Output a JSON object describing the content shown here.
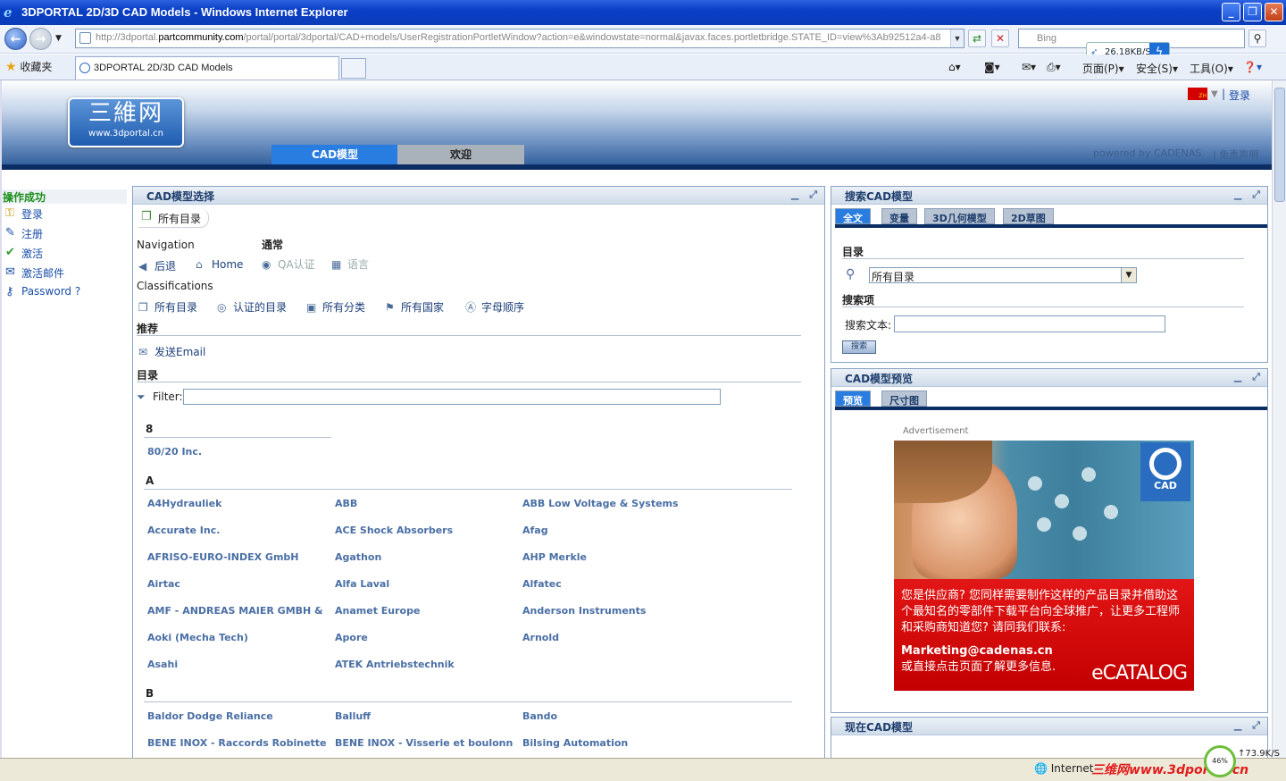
{
  "window": {
    "title": "3DPORTAL 2D/3D CAD Models - Windows Internet Explorer"
  },
  "browser": {
    "address_prefix": "http://3dportal.",
    "address_domain": "partcommunity.com",
    "address_rest": "/portal/portal/3dportal/CAD+models/UserRegistrationPortletWindow?action=e&windowstate=normal&javax.faces.portletbridge.STATE_ID=view%3Ab92512a4-a8",
    "search_placeholder": "Bing",
    "speed": "26.18KB/S",
    "favorites_label": "收藏夹",
    "tab_title": "3DPORTAL 2D/3D CAD Models",
    "cmd_page": "页面(P)",
    "cmd_safety": "安全(S)",
    "cmd_tools": "工具(O)"
  },
  "header": {
    "logo_cn": "三維网",
    "logo_url": "www.3dportal.cn",
    "tabs": [
      "CAD模型",
      "欢迎"
    ],
    "lang": "ZH",
    "login": "登录",
    "powered": "powered by CADENAS",
    "disclaimer": "| 免责声明"
  },
  "leftmenu": {
    "status": "操作成功",
    "items": [
      "登录",
      "注册",
      "激活",
      "激活邮件",
      "Password ?"
    ]
  },
  "cad_select": {
    "title": "CAD模型选择",
    "crumb": "所有目录",
    "navigation_label": "Navigation",
    "general_label": "通常",
    "back": "后退",
    "home": "Home",
    "qa": "QA认证",
    "language": "语言",
    "classifications_label": "Classifications",
    "classifications": [
      "所有目录",
      "认证的目录",
      "所有分类",
      "所有国家",
      "字母顺序"
    ],
    "recommend_label": "推荐",
    "send_email": "发送Email",
    "catalog_label": "目录",
    "filter_label": "Filter:",
    "groups": [
      {
        "letter": "8",
        "items": [
          "80/20 Inc."
        ]
      },
      {
        "letter": "A",
        "items": [
          "A4Hydrauliek",
          "ABB",
          "ABB Low Voltage & Systems",
          "Accurate Inc.",
          "ACE Shock Absorbers",
          "Afag",
          "AFRISO-EURO-INDEX GmbH",
          "Agathon",
          "AHP Merkle",
          "Airtac",
          "Alfa Laval",
          "Alfatec",
          "AMF - ANDREAS MAIER GMBH & CO KG",
          "Anamet Europe",
          "Anderson Instruments",
          "Aoki (Mecha Tech)",
          "Apore",
          "Arnold",
          "Asahi",
          "ATEK Antriebstechnik"
        ]
      },
      {
        "letter": "B",
        "items": [
          "Baldor Dodge Reliance",
          "Balluff",
          "Bando",
          "BENE INOX - Raccords Robinetterie - Accessoires",
          "BENE INOX - Visserie et boulonnerie",
          "Bilsing Automation"
        ]
      }
    ]
  },
  "search": {
    "title": "搜索CAD模型",
    "tabs": [
      "全文",
      "变量",
      "3D几何模型",
      "2D草图"
    ],
    "catalog_label": "目录",
    "catalog_value": "所有目录",
    "search_item_label": "搜索项",
    "search_text_label": "搜索文本:",
    "search_button": "搜索"
  },
  "preview": {
    "title": "CAD模型预览",
    "tabs": [
      "预览",
      "尺寸图"
    ],
    "ad_label": "Advertisement",
    "ad_logo": "CAD",
    "ad_text": "您是供应商? 您同样需要制作这样的产品目录并借助这个最知名的零部件下载平台向全球推广，让更多工程师和采购商知道您? 请同我们联系:",
    "ad_mail": "Marketing@cadenas.cn",
    "ad_more": "或直接点击页面了解更多信息.",
    "ad_brand": "eCATALOG"
  },
  "current": {
    "title": "现在CAD模型"
  },
  "statusbar": {
    "zone": "Internet",
    "watermark": "三维网www.3dportal.cn",
    "gauge": "46%",
    "speed": "73.9K/S"
  },
  "colors": {
    "accent": "#2a7de0",
    "dark_stripe": "#0a2d63",
    "link": "#4a6fa5",
    "ad_red": "#d40000"
  }
}
